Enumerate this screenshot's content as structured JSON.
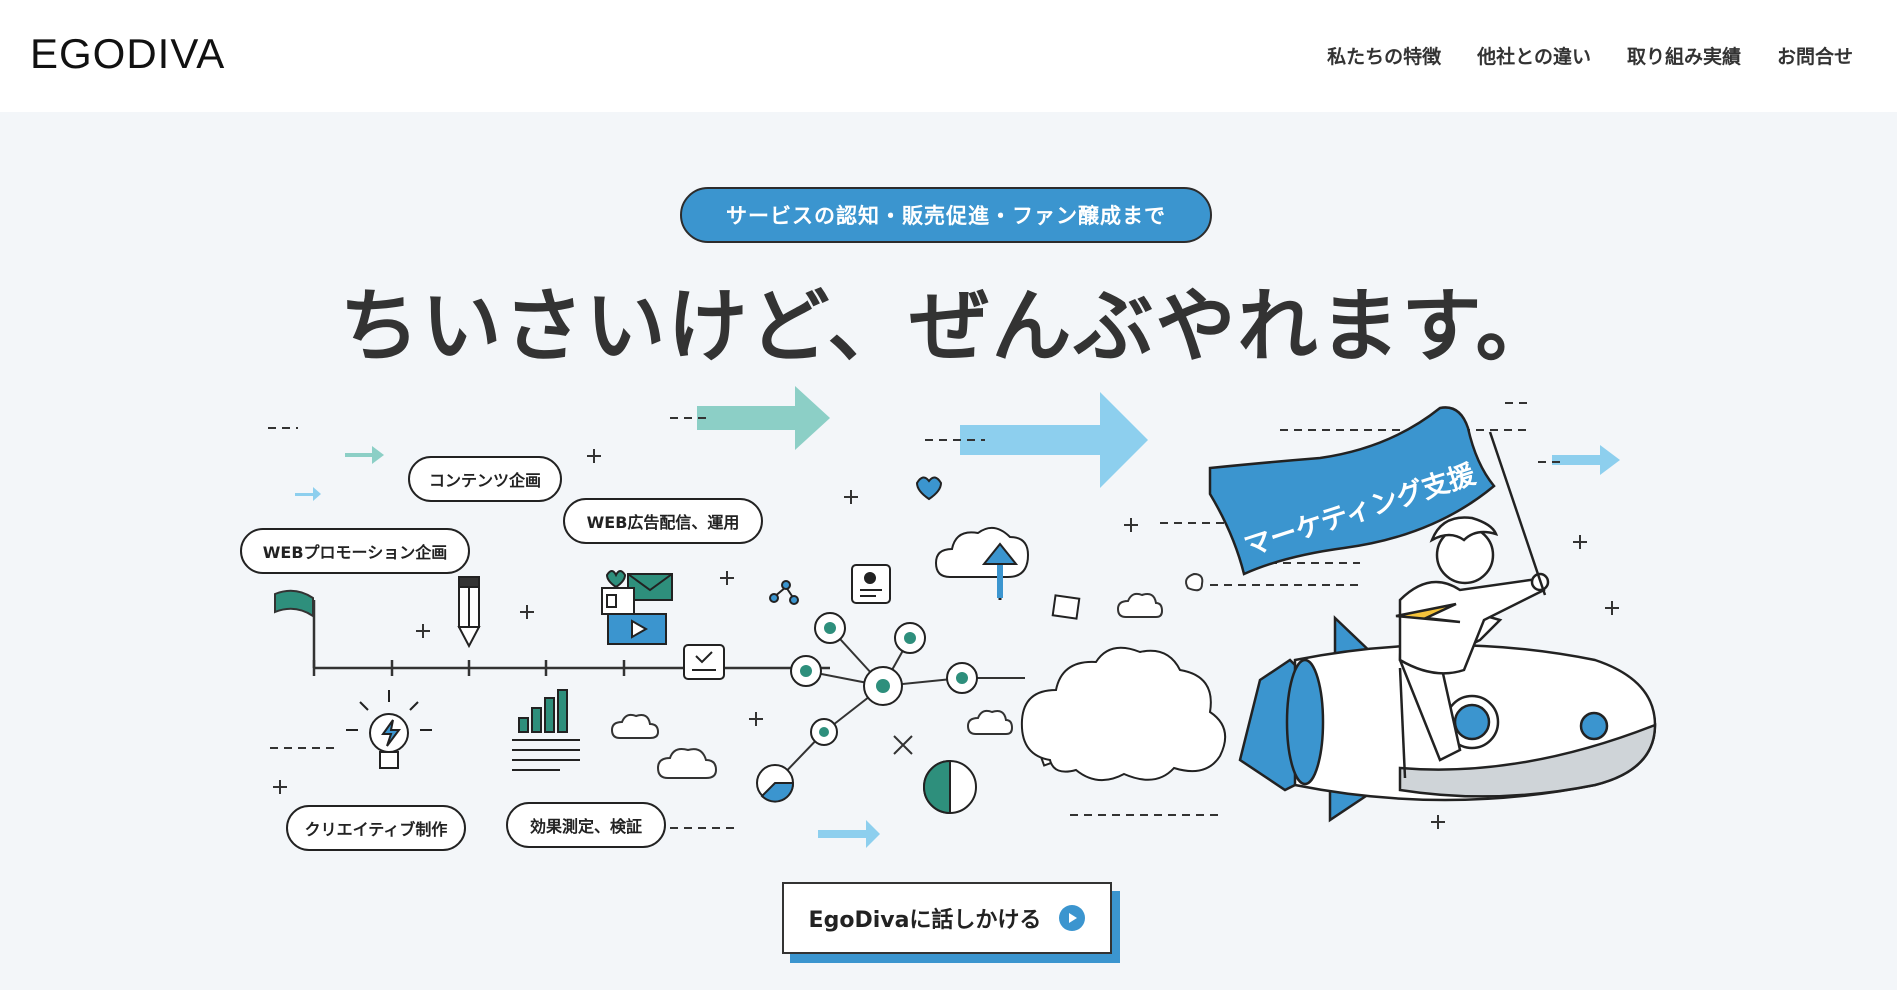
{
  "header": {
    "logo": "EGODIVA",
    "nav": [
      {
        "label": "私たちの特徴"
      },
      {
        "label": "他社との違い"
      },
      {
        "label": "取り組み実績"
      },
      {
        "label": "お問合せ"
      }
    ]
  },
  "hero": {
    "badge": "サービスの認知・販売促進・ファン醸成まで",
    "headline": "ちいさいけど、ぜんぶやれます。",
    "flag_text": "マーケティング支援",
    "bubbles": {
      "contents": "コンテンツ企画",
      "web_promo": "WEBプロモーション企画",
      "web_ads": "WEB広告配信、運用",
      "creative": "クリエイティブ制作",
      "measure": "効果測定、検証"
    }
  },
  "cta": {
    "label": "EgoDivaに話しかける",
    "icon": "play-circle-icon"
  },
  "colors": {
    "accent_blue": "#3b95cf",
    "teal": "#2e8f7c",
    "light_arrow": "#8dcfee",
    "mint_arrow": "#8ccfc6",
    "background": "#f3f6f9"
  }
}
